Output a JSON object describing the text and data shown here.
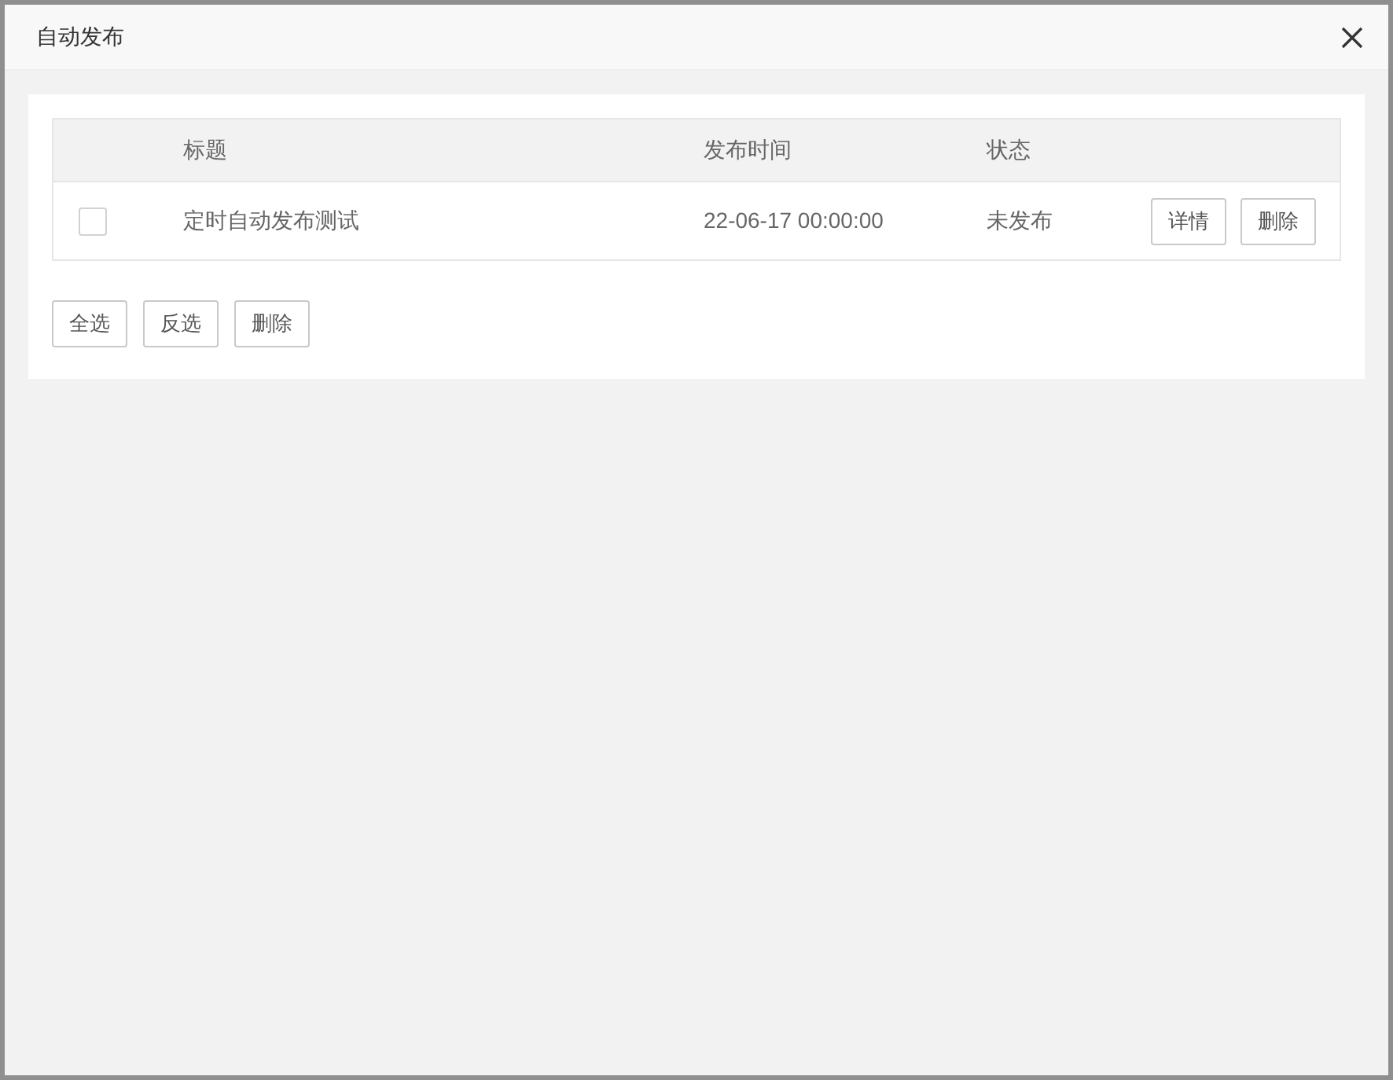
{
  "dialog": {
    "title": "自动发布"
  },
  "table": {
    "columns": [
      "标题",
      "发布时间",
      "状态"
    ],
    "rows": [
      {
        "checked": false,
        "title": "定时自动发布测试",
        "time": "22-06-17 00:00:00",
        "status": "未发布",
        "actions": [
          "详情",
          "删除"
        ]
      }
    ]
  },
  "buttons": [
    "全选",
    "反选",
    "删除"
  ]
}
